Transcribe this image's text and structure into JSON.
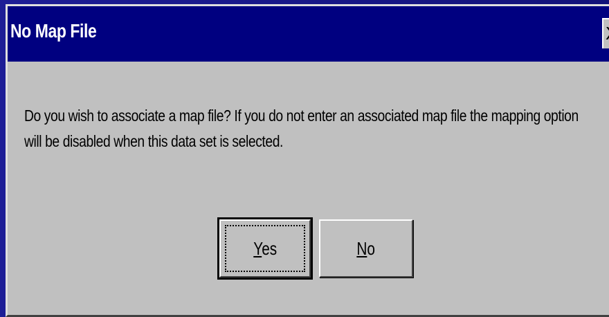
{
  "dialog": {
    "title": "No Map File",
    "close_glyph": "X",
    "message_lines": [
      "Do you wish to associate a map file? If you do not enter an associated map file the mapping option",
      "will be disabled when this data set is selected."
    ],
    "buttons": {
      "yes": {
        "mnemonic": "Y",
        "rest": "es",
        "is_default": true
      },
      "no": {
        "mnemonic": "N",
        "rest": "o",
        "is_default": false
      }
    }
  },
  "colors": {
    "titlebar": "#000080",
    "dialog_face": "#c0c0c0",
    "desktop": "#1a1a8c"
  }
}
